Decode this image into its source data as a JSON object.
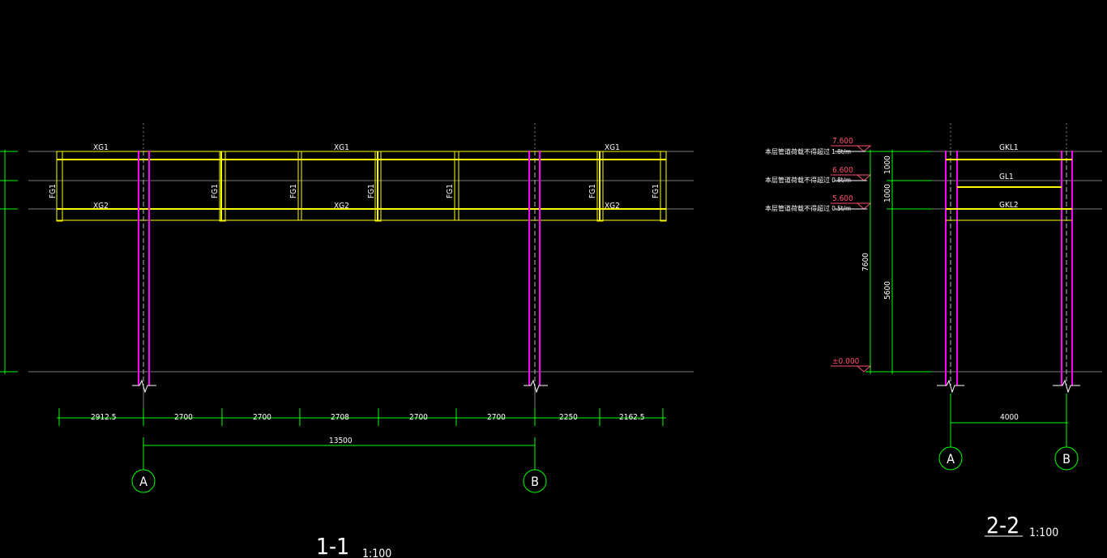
{
  "section_1": {
    "top_beam_labels": [
      "XG1",
      "XG1",
      "XG1"
    ],
    "bottom_beam_labels": [
      "XG2",
      "XG2",
      "XG2"
    ],
    "post_label": "FG1",
    "span_dims": [
      "2912.5",
      "2700",
      "2700",
      "2708",
      "2700",
      "2700",
      "2250",
      "2162.5"
    ],
    "total_dim": "13500",
    "axis_a": "A",
    "axis_b": "B",
    "title": "1-1",
    "scale": "1:100"
  },
  "section_2": {
    "beam_labels": [
      "GKL1",
      "GL1",
      "GKL2"
    ],
    "elevations": [
      "7.600",
      "6.600",
      "5.600",
      "±0.000"
    ],
    "load_notes": [
      "本层管道荷载不得超过 1.8t/m",
      "本层管道荷载不得超过 0.8t/m",
      "本层管道荷载不得超过 0.5t/m"
    ],
    "vertical_dims_inner": [
      "1000",
      "1000",
      "5600"
    ],
    "vertical_dim_total": "7600",
    "width_dim": "4000",
    "axis_a": "A",
    "axis_b": "B",
    "title": "2-2",
    "scale": "1:100"
  },
  "colors": {
    "background": "#000000",
    "beam": "#ffff00",
    "column": "#ff00ff",
    "dimension": "#00ff00",
    "reference": "#808080",
    "elevation": "#ff4d6d",
    "text": "#ffffff"
  }
}
